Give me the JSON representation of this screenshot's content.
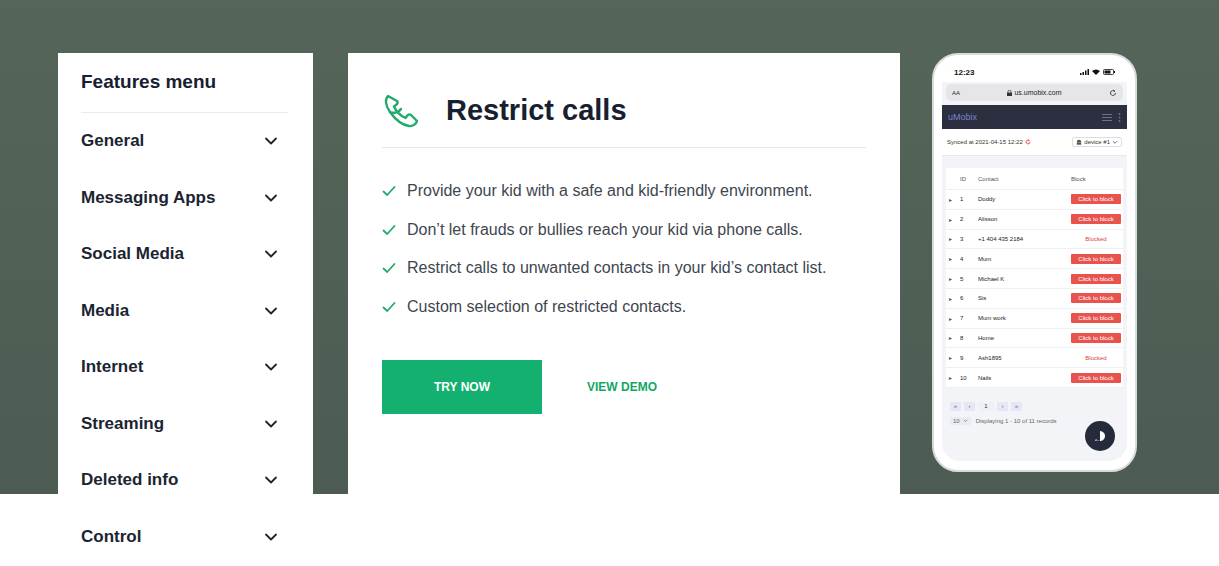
{
  "menu": {
    "title": "Features menu",
    "items": [
      {
        "label": "General",
        "expanded": false
      },
      {
        "label": "Messaging Apps",
        "expanded": false
      },
      {
        "label": "Social Media",
        "expanded": false
      },
      {
        "label": "Media",
        "expanded": false
      },
      {
        "label": "Internet",
        "expanded": false
      },
      {
        "label": "Streaming",
        "expanded": false
      },
      {
        "label": "Deleted info",
        "expanded": false
      },
      {
        "label": "Control",
        "expanded": false
      }
    ]
  },
  "feature": {
    "title": "Restrict calls",
    "points": [
      "Provide your kid with a safe and kid-friendly environment.",
      "Don’t let frauds or bullies reach your kid via phone calls.",
      "Restrict calls to unwanted contacts in your kid’s contact list.",
      "Custom selection of restricted contacts."
    ],
    "primary_button": "TRY NOW",
    "secondary_button": "VIEW DEMO"
  },
  "phone": {
    "time": "12:23",
    "text_size": "AA",
    "url": "us.umobix.com",
    "app": "uMobix",
    "synced": "Synced at 2021-04-15 12:22",
    "device": "device #1",
    "table": {
      "columns": [
        "ID",
        "Contact",
        "Block"
      ],
      "row_marker": "▸",
      "block_action": "Click to block",
      "blocked_label": "Blocked",
      "rows": [
        {
          "id": "1",
          "contact": "Doddy",
          "blocked": false
        },
        {
          "id": "2",
          "contact": "Alisson",
          "blocked": false
        },
        {
          "id": "3",
          "contact": "+1 404 435 2184",
          "blocked": true
        },
        {
          "id": "4",
          "contact": "Mum",
          "blocked": false
        },
        {
          "id": "5",
          "contact": "Michael K",
          "blocked": false
        },
        {
          "id": "6",
          "contact": "Sis",
          "blocked": false
        },
        {
          "id": "7",
          "contact": "Mum work",
          "blocked": false
        },
        {
          "id": "8",
          "contact": "Home",
          "blocked": false
        },
        {
          "id": "9",
          "contact": "Ash1895",
          "blocked": true
        },
        {
          "id": "10",
          "contact": "Nails",
          "blocked": false
        }
      ]
    },
    "pagination": [
      {
        "label": "«",
        "selected": false
      },
      {
        "label": "‹",
        "selected": false
      },
      {
        "label": "1",
        "selected": true
      },
      {
        "label": "›",
        "selected": false
      },
      {
        "label": "»",
        "selected": false
      }
    ],
    "page_size": "10",
    "summary": "Displaying 1 - 10 of 11 records"
  }
}
